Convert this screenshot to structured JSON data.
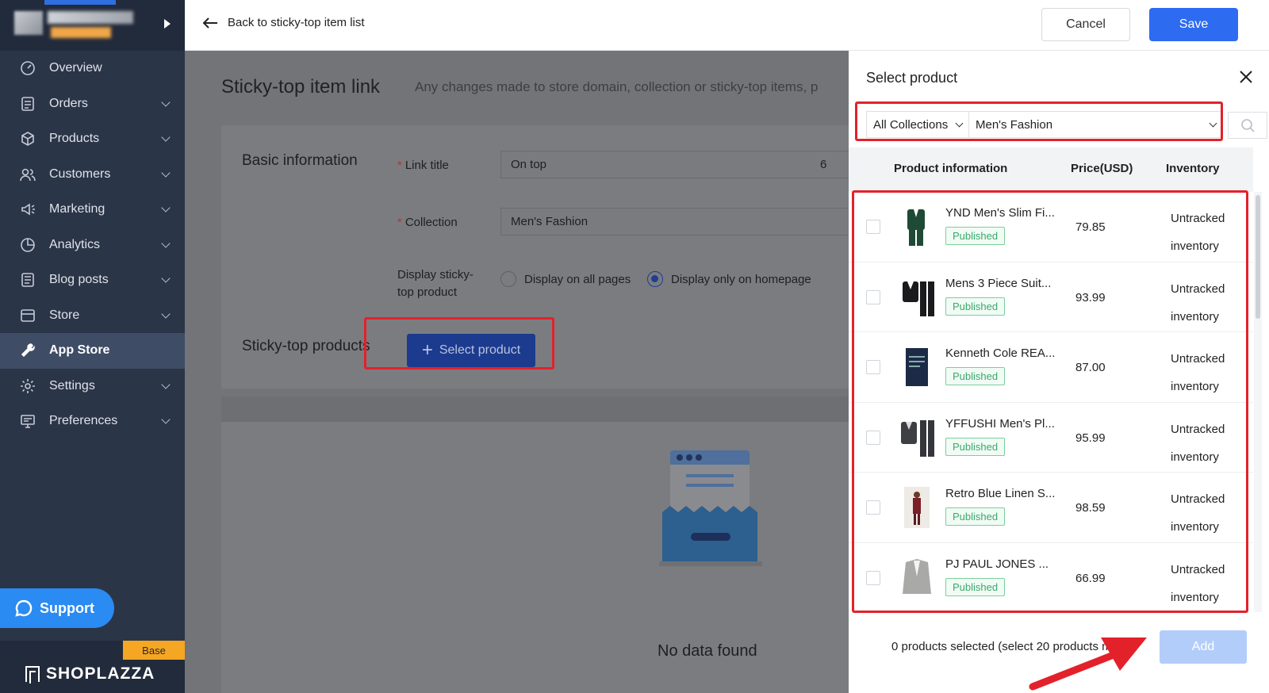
{
  "sidebar": {
    "items": [
      {
        "label": "Overview",
        "icon": "gauge-icon",
        "chevron": false,
        "active": false
      },
      {
        "label": "Orders",
        "icon": "orders-icon",
        "chevron": true,
        "active": false
      },
      {
        "label": "Products",
        "icon": "box-icon",
        "chevron": true,
        "active": false
      },
      {
        "label": "Customers",
        "icon": "users-icon",
        "chevron": true,
        "active": false
      },
      {
        "label": "Marketing",
        "icon": "megaphone-icon",
        "chevron": true,
        "active": false
      },
      {
        "label": "Analytics",
        "icon": "pie-chart-icon",
        "chevron": true,
        "active": false
      },
      {
        "label": "Blog posts",
        "icon": "document-icon",
        "chevron": true,
        "active": false
      },
      {
        "label": "Store",
        "icon": "store-icon",
        "chevron": true,
        "active": false
      },
      {
        "label": "App Store",
        "icon": "wrench-icon",
        "chevron": false,
        "active": true
      },
      {
        "label": "Settings",
        "icon": "gear-icon",
        "chevron": true,
        "active": false
      },
      {
        "label": "Preferences",
        "icon": "monitor-icon",
        "chevron": true,
        "active": false
      }
    ],
    "support_label": "Support",
    "base_badge": "Base",
    "brand": "SHOPLAZZA"
  },
  "topbar": {
    "back_label": "Back to sticky-top item list",
    "cancel_label": "Cancel",
    "save_label": "Save"
  },
  "main": {
    "title": "Sticky-top item link",
    "description": "Any changes made to store domain, collection or sticky-top items, p",
    "basic_info_label": "Basic information",
    "link_title_label": "Link title",
    "link_title_value": "On top",
    "link_title_counter": "6",
    "collection_label": "Collection",
    "collection_value": "Men's Fashion",
    "display_label_line1": "Display sticky-",
    "display_label_line2": "top product",
    "radio_all_pages": "Display on all pages",
    "radio_homepage": "Display only on homepage",
    "sticky_products_label": "Sticky-top products",
    "select_product_label": "Select product",
    "empty_text": "No data found"
  },
  "drawer": {
    "title": "Select product",
    "collection_filter": "All Collections",
    "collection_value": "Men's Fashion",
    "columns": {
      "product": "Product information",
      "price": "Price(USD)",
      "inventory": "Inventory"
    },
    "products": [
      {
        "name": "YND Men's Slim Fi...",
        "status": "Published",
        "price": "79.85",
        "inv1": "Untracked",
        "inv2": "inventory",
        "thumb": "green-suit"
      },
      {
        "name": "Mens 3 Piece Suit...",
        "status": "Published",
        "price": "93.99",
        "inv1": "Untracked",
        "inv2": "inventory",
        "thumb": "black-suit"
      },
      {
        "name": "Kenneth Cole REA...",
        "status": "Published",
        "price": "87.00",
        "inv1": "Untracked",
        "inv2": "inventory",
        "thumb": "navy-box"
      },
      {
        "name": "YFFUSHI Men's Pl...",
        "status": "Published",
        "price": "95.99",
        "inv1": "Untracked",
        "inv2": "inventory",
        "thumb": "grey-suit"
      },
      {
        "name": "Retro Blue Linen S...",
        "status": "Published",
        "price": "98.59",
        "inv1": "Untracked",
        "inv2": "inventory",
        "thumb": "red-person"
      },
      {
        "name": "PJ PAUL JONES ...",
        "status": "Published",
        "price": "66.99",
        "inv1": "Untracked",
        "inv2": "inventory",
        "thumb": "grey-jacket"
      }
    ],
    "footer_text": "0 products selected (select 20 products m   )",
    "add_label": "Add"
  },
  "colors": {
    "sidebar_bg": "#2b3548",
    "primary": "#2d6bf1",
    "highlight_red": "#e3212a",
    "published_green": "#3aa86a"
  }
}
